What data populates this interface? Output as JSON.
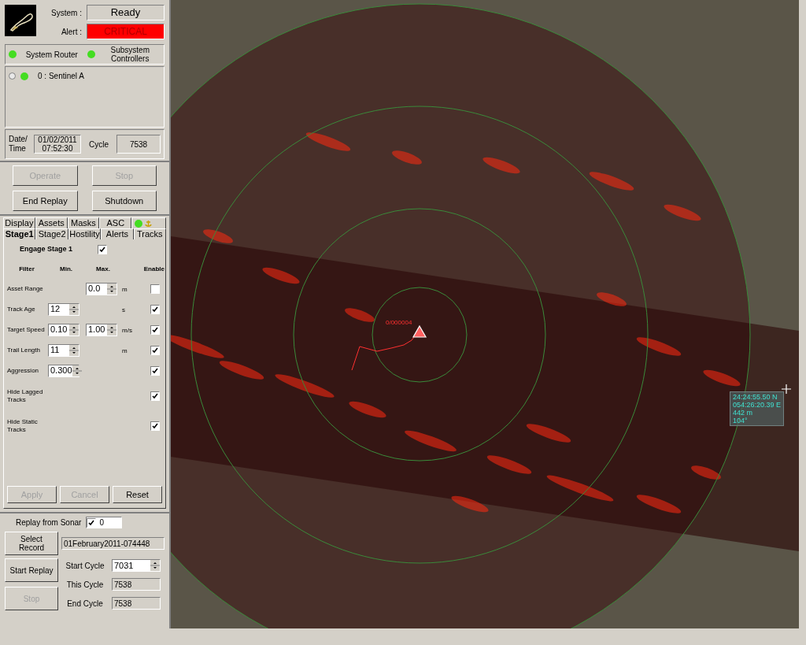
{
  "header": {
    "system_label": "System :",
    "system_value": "Ready",
    "alert_label": "Alert :",
    "alert_value": "CRITICAL"
  },
  "status_lights": [
    {
      "label": "System Router",
      "on": true
    },
    {
      "label": "Subsystem Controllers",
      "on": true
    }
  ],
  "sentinels": [
    {
      "label": "0 : Sentinel A",
      "selected": false,
      "online": true
    }
  ],
  "clock": {
    "date_label": "Date/ Time",
    "date_value": "01/02/2011 07:52:30",
    "cycle_label": "Cycle",
    "cycle_value": "7538"
  },
  "control_buttons": [
    {
      "label": "Operate",
      "disabled": true
    },
    {
      "label": "Stop",
      "disabled": true
    },
    {
      "label": "End Replay",
      "disabled": false
    },
    {
      "label": "Shutdown",
      "disabled": false
    }
  ],
  "tab_rows": [
    [
      {
        "label": "Display",
        "selected": false
      },
      {
        "label": "Assets",
        "selected": false
      },
      {
        "label": "Masks",
        "selected": false
      },
      {
        "label": "ASC",
        "selected": false
      }
    ],
    [
      {
        "label": "Stage1",
        "selected": true
      },
      {
        "label": "Stage2",
        "selected": false
      },
      {
        "label": "Hostility",
        "selected": false
      },
      {
        "label": "Alerts",
        "selected": false
      },
      {
        "label": "Tracks",
        "selected": false
      }
    ]
  ],
  "status_tab": {
    "light_on": true
  },
  "stage": {
    "engage": {
      "label": "Engage Stage 1",
      "checked": true
    },
    "columns": [
      "Filter",
      "Min.",
      "Max.",
      "Enable"
    ],
    "filters": [
      {
        "name": "Asset Range",
        "max": "0.0",
        "unit": "m",
        "enabled": false
      },
      {
        "name": "Track Age",
        "min": "12",
        "unit": "s",
        "enabled": true
      },
      {
        "name": "Target Speed",
        "min": "0.10",
        "max": "1.00",
        "unit": "m/s",
        "enabled": true
      },
      {
        "name": "Trail Length",
        "min": "11",
        "unit": "m",
        "enabled": true
      },
      {
        "name": "Aggression",
        "min": "0.300",
        "enabled": true
      },
      {
        "name": "Hide Lagged Tracks",
        "enabled": true
      },
      {
        "name": "Hide Static Tracks",
        "enabled": true
      }
    ],
    "buttons": [
      {
        "label": "Apply",
        "disabled": true
      },
      {
        "label": "Cancel",
        "disabled": true
      },
      {
        "label": "Reset",
        "disabled": false
      }
    ]
  },
  "replay": {
    "source_label": "Replay from Sonar",
    "source_checked": true,
    "source_value": "0",
    "select_button": "Select Record",
    "record": "01February2011-074448",
    "start_button": {
      "label": "Start Replay",
      "disabled": false
    },
    "stop_button": {
      "label": "Stop",
      "disabled": true
    },
    "fields": [
      {
        "label": "Start Cycle",
        "value": "7031",
        "kind": "spin"
      },
      {
        "label": "This Cycle",
        "value": "7538",
        "kind": "readonly"
      },
      {
        "label": "End Cycle",
        "value": "7538",
        "kind": "readonly"
      }
    ]
  },
  "map": {
    "target_label": "0/000004",
    "readout": [
      "24:24:55.50 N",
      "054:26:20.39 E",
      "442 m",
      "104°"
    ]
  }
}
